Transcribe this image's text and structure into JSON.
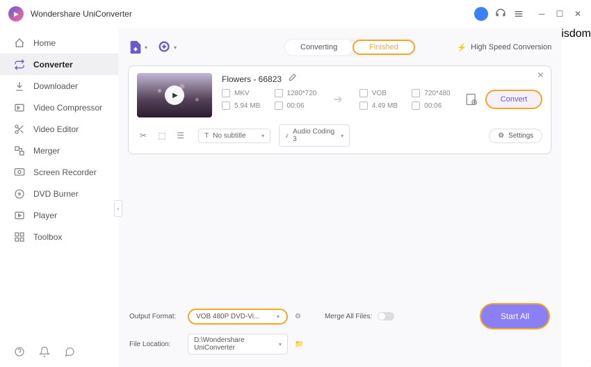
{
  "app": {
    "title": "Wondershare UniConverter"
  },
  "sidebar": {
    "items": [
      {
        "label": "Home"
      },
      {
        "label": "Converter"
      },
      {
        "label": "Downloader"
      },
      {
        "label": "Video Compressor"
      },
      {
        "label": "Video Editor"
      },
      {
        "label": "Merger"
      },
      {
        "label": "Screen Recorder"
      },
      {
        "label": "DVD Burner"
      },
      {
        "label": "Player"
      },
      {
        "label": "Toolbox"
      }
    ]
  },
  "toolbar": {
    "tabs": {
      "converting": "Converting",
      "finished": "Finished"
    },
    "hsc": "High Speed Conversion"
  },
  "card": {
    "title": "Flowers - 66823",
    "src": {
      "format": "MKV",
      "res": "1280*720",
      "size": "5.94 MB",
      "dur": "00:06"
    },
    "dst": {
      "format": "VOB",
      "res": "720*480",
      "size": "4.49 MB",
      "dur": "00:06"
    },
    "subtitle": "No subtitle",
    "audio": "Audio Coding 3",
    "settings": "Settings",
    "convert": "Convert"
  },
  "footer": {
    "output_label": "Output Format:",
    "output_value": "VOB 480P DVD-Vi...",
    "location_label": "File Location:",
    "location_value": "D:\\Wondershare UniConverter",
    "merge_label": "Merge All Files:",
    "start_all": "Start All"
  }
}
